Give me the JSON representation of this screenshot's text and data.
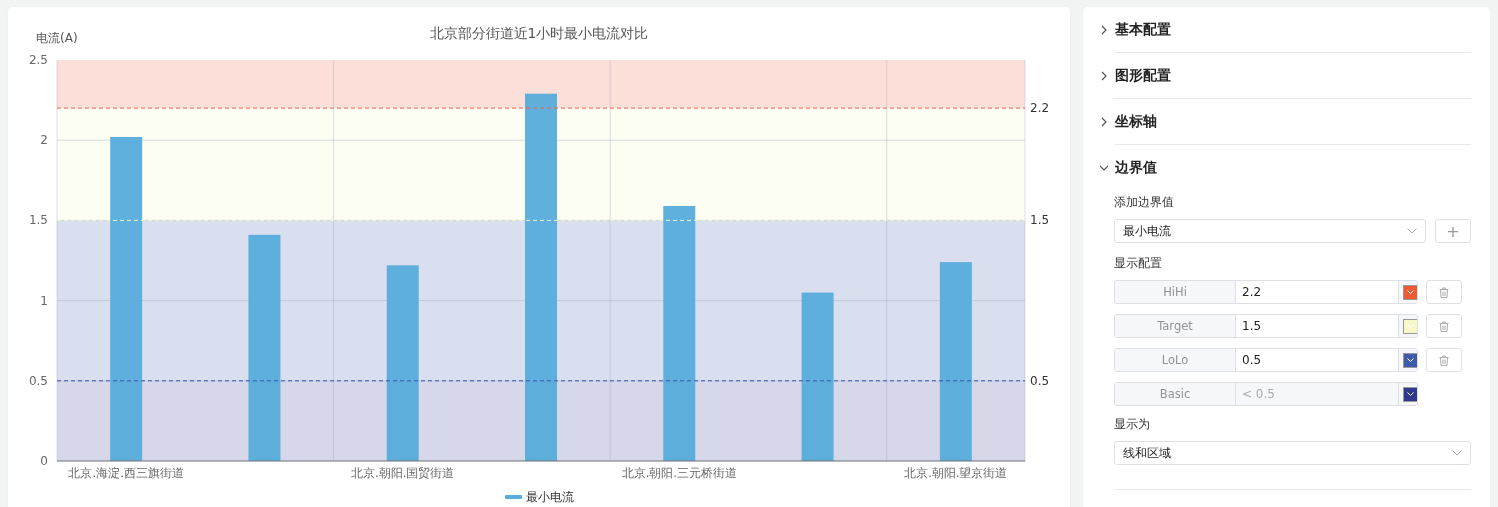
{
  "chart": {
    "chart_data": {
      "type": "bar",
      "title": "北京部分街道近1小时最小电流对比",
      "ylabel": "电流(A)",
      "categories": [
        "北京.海淀.西三旗街道",
        null,
        "北京.朝阳.国贸街道",
        null,
        "北京.朝阳.三元桥街道",
        null,
        "北京.朝阳.望京街道"
      ],
      "series": [
        {
          "name": "最小电流",
          "color": "#57acdb",
          "values": [
            2.02,
            1.41,
            1.22,
            2.29,
            1.59,
            1.05,
            1.24
          ]
        }
      ],
      "ylim": [
        0,
        2.5
      ],
      "yticks": [
        0,
        0.5,
        1,
        1.5,
        2,
        2.5
      ],
      "grid": true,
      "bands": [
        {
          "axis": "y",
          "from": 2.2,
          "to": 2.5,
          "color": "#fcdfd8"
        },
        {
          "axis": "y",
          "from": 1.5,
          "to": 2.2,
          "color": "#fcfdf3"
        },
        {
          "axis": "y",
          "from": 0.5,
          "to": 1.5,
          "color": "#d9dfee"
        },
        {
          "axis": "y",
          "from": 0,
          "to": 0.5,
          "color": "#d7d7ea"
        }
      ],
      "ref_lines": [
        {
          "axis": "y",
          "value": 2.2,
          "label": "2.2",
          "color": "#ee6644"
        },
        {
          "axis": "y",
          "value": 1.5,
          "label": "1.5",
          "color": "#f0f2c0"
        },
        {
          "axis": "y",
          "value": 0.5,
          "label": "0.5",
          "color": "#3355aa"
        }
      ]
    }
  },
  "panel": {
    "sections": [
      {
        "title": "基本配置",
        "expanded": false
      },
      {
        "title": "图形配置",
        "expanded": false
      },
      {
        "title": "坐标轴",
        "expanded": false
      },
      {
        "title": "边界值",
        "expanded": true,
        "add_label": "添加边界值",
        "add_select": "最小电流",
        "add_button": "+",
        "display_label": "显示配置",
        "thresholds": [
          {
            "name": "HiHi",
            "value": "2.2",
            "color": "#ee5a33",
            "disabled": false
          },
          {
            "name": "Target",
            "value": "1.5",
            "color": "#f6f8c8",
            "disabled": false
          },
          {
            "name": "LoLo",
            "value": "0.5",
            "color": "#3f5aa8",
            "disabled": false
          },
          {
            "name": "Basic",
            "value": "< 0.5",
            "color": "#2f3a8c",
            "disabled": true
          }
        ],
        "show_as_label": "显示为",
        "show_as_select": "线和区域"
      }
    ]
  }
}
